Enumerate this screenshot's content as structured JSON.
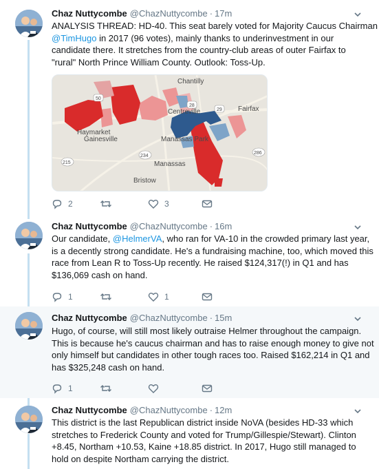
{
  "author": {
    "name": "Chaz Nuttycombe",
    "handle": "@ChazNuttycombe"
  },
  "colors": {
    "link": "#1b95e0",
    "muted": "#657786",
    "thread_line": "#c4dff0",
    "highlight_bg": "#f5f8fa",
    "dem_dark": "#2e5a8e",
    "dem_light": "#7ea4c8",
    "rep_dark": "#d92b2b",
    "rep_light": "#ec9595"
  },
  "tweets": [
    {
      "time": "17m",
      "lines": [
        "ANALYSIS THREAD: HD-40. This seat barely voted for Majority Caucus Chairman",
        "in 2017 (96 votes), mainly thanks to underinvestment in our",
        "candidate there. It stretches from the country-club areas of outer Fairfax to",
        "\"rural\" North Prince William County. Outlook: Toss-Up."
      ],
      "mention": "@TimHugo",
      "map_labels": {
        "chantilly": "Chantilly",
        "centreville": "Centreville",
        "fairfax": "Fairfax",
        "haymarket": "Haymarket",
        "gainesville": "Gainesville",
        "manassas_park": "Manassas Park",
        "manassas": "Manassas",
        "bristow": "Bristow",
        "route_50": "50",
        "route_28": "28",
        "route_29": "29",
        "route_234": "234",
        "route_215": "215",
        "route_286": "286"
      },
      "replies": "2",
      "retweets": "",
      "likes": "3"
    },
    {
      "time": "16m",
      "lines_1_pre": "Our candidate, ",
      "mention": "@HelmerVA",
      "lines_1_post": ", who ran for VA-10 in the crowded primary last year,",
      "lines": [
        "is a decently strong candidate. He's a fundraising machine, too, which moved this",
        "race from Lean R to Toss-Up recently. He raised $124,317(!) in Q1 and has",
        "$136,069 cash on hand."
      ],
      "replies": "1",
      "retweets": "",
      "likes": "1"
    },
    {
      "time": "15m",
      "lines": [
        "Hugo, of course, will still most likely outraise Helmer throughout the campaign.",
        "This is because he's caucus chairman and has to raise enough money to give not",
        "only himself but candidates in other tough races too. Raised $162,214 in Q1 and",
        "has $325,248 cash on hand."
      ],
      "replies": "1",
      "retweets": "",
      "likes": ""
    },
    {
      "time": "12m",
      "lines": [
        "This district is the last Republican district inside NoVA (besides HD-33 which",
        "stretches to Frederick County and voted for Trump/Gillespie/Stewart). Clinton",
        "+8.45, Northam +10.53, Kaine +18.85 district. In 2017, Hugo still managed to",
        "hold on despite Northam carrying the district."
      ]
    }
  ]
}
